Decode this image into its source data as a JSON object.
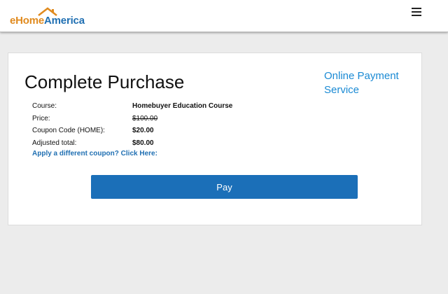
{
  "header": {
    "logo": {
      "part1": "eHome",
      "part2": "America"
    },
    "menu_icon": "hamburger-menu-icon"
  },
  "main": {
    "title": "Complete Purchase",
    "side_link": "Online Payment Service",
    "details": [
      {
        "label": "Course:",
        "value": "Homebuyer Education Course",
        "strike": false
      },
      {
        "label": "Price:",
        "value": "$100.00",
        "strike": true
      },
      {
        "label": "Coupon Code (HOME):",
        "value": "$20.00",
        "strike": false
      },
      {
        "label": "Adjusted total:",
        "value": "$80.00",
        "strike": false
      }
    ],
    "coupon_link": "Apply a different coupon? Click Here:",
    "pay_button": "Pay"
  },
  "colors": {
    "brand_orange": "#e08a1e",
    "brand_blue": "#1f6fb2",
    "link_blue": "#1a8ad4",
    "button_blue": "#1b6fb8",
    "page_bg": "#ececec"
  }
}
